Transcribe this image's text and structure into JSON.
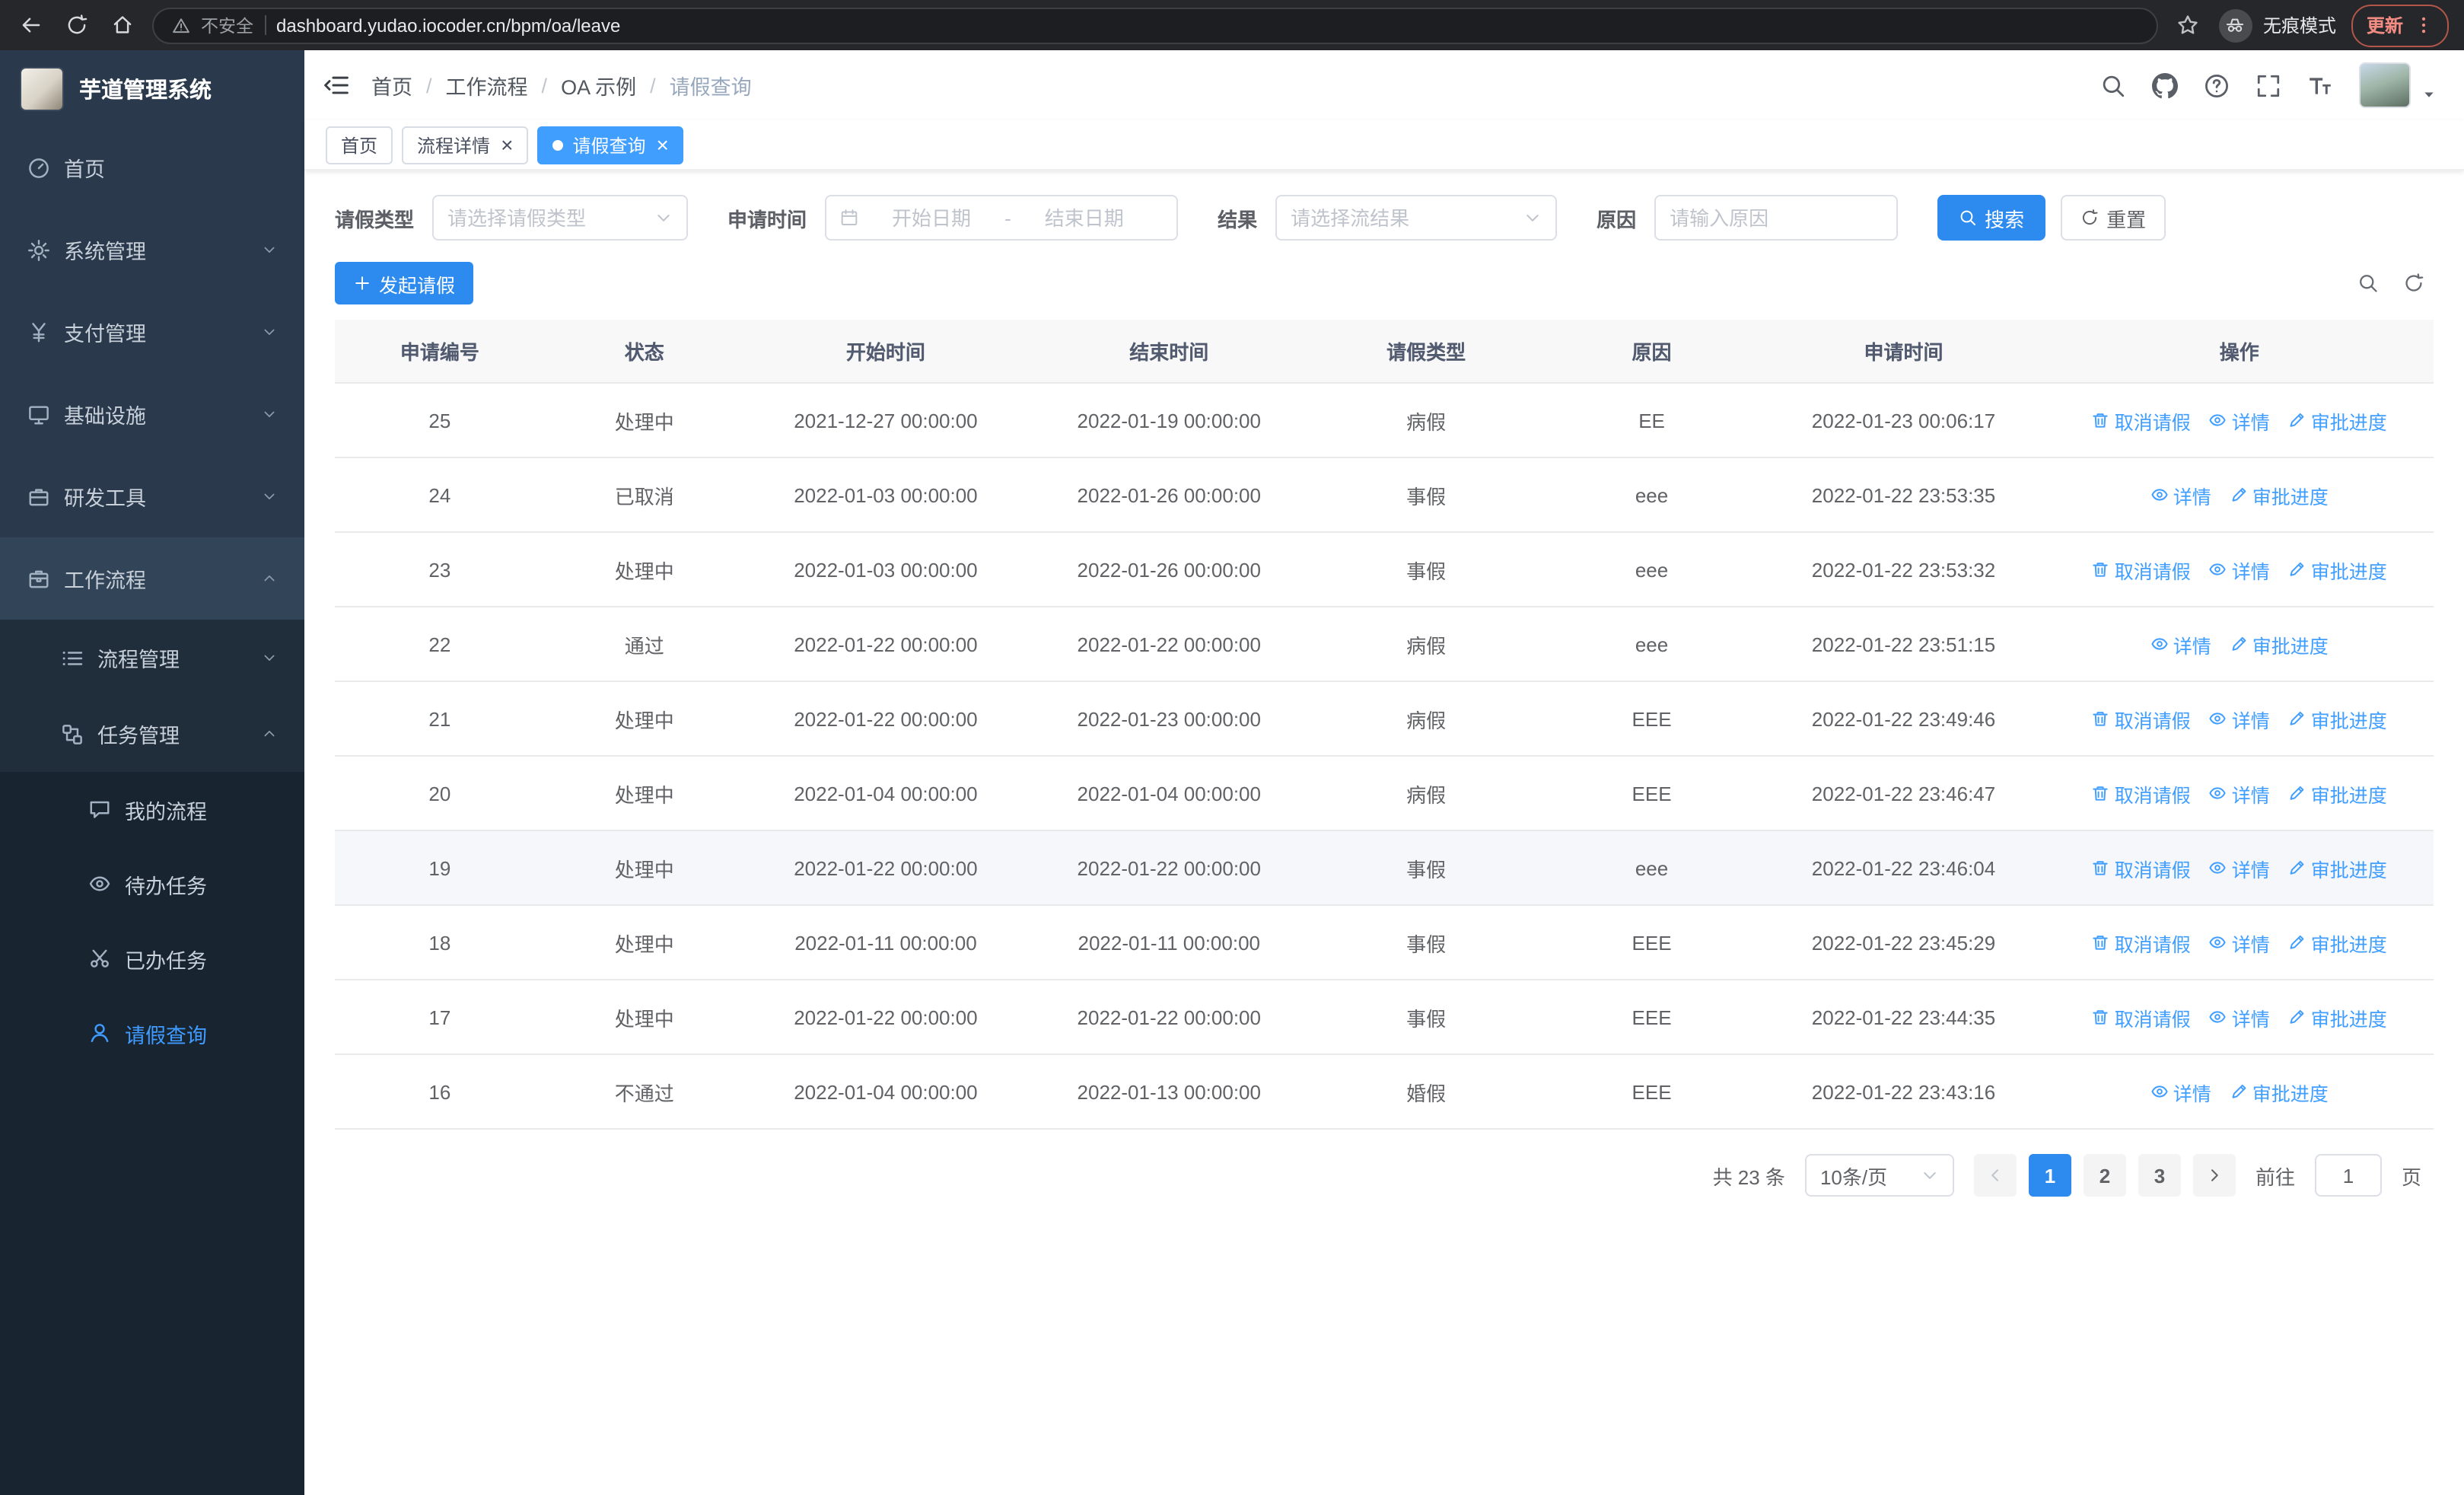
{
  "colors": {
    "primary": "#2d8bf0",
    "link": "#409eff",
    "sidebar_bg": "#2a3a4c",
    "sidebar_active_text": "#3f9bff",
    "tab_active_bg": "#409eff",
    "update_accent": "#f28b82",
    "table_header_bg": "#f8f8f9"
  },
  "browser": {
    "security_label": "不安全",
    "url": "dashboard.yudao.iocoder.cn/bpm/oa/leave",
    "incognito_label": "无痕模式",
    "update_label": "更新"
  },
  "sidebar": {
    "logo_title": "芋道管理系统",
    "menu": [
      {
        "key": "home",
        "label": "首页",
        "icon": "dashboard-icon",
        "level": 1
      },
      {
        "key": "system",
        "label": "系统管理",
        "icon": "gear-icon",
        "level": 1,
        "arrow": "down"
      },
      {
        "key": "payment",
        "label": "支付管理",
        "icon": "payment-icon",
        "level": 1,
        "arrow": "down"
      },
      {
        "key": "infrastructure",
        "label": "基础设施",
        "icon": "infrastructure-icon",
        "level": 1,
        "arrow": "down"
      },
      {
        "key": "devtools",
        "label": "研发工具",
        "icon": "devtools-icon",
        "level": 1,
        "arrow": "down"
      },
      {
        "key": "workflow",
        "label": "工作流程",
        "icon": "workflow-icon",
        "level": 1,
        "arrow": "up",
        "expanded": true
      },
      {
        "key": "process-mgmt",
        "label": "流程管理",
        "icon": "process-icon",
        "level": 2,
        "arrow": "down"
      },
      {
        "key": "task-mgmt",
        "label": "任务管理",
        "icon": "task-icon",
        "level": 2,
        "arrow": "up",
        "expanded": true
      },
      {
        "key": "my-process",
        "label": "我的流程",
        "icon": "my-process-icon",
        "level": 3
      },
      {
        "key": "todo-tasks",
        "label": "待办任务",
        "icon": "todo-icon",
        "level": 3
      },
      {
        "key": "done-tasks",
        "label": "已办任务",
        "icon": "done-icon",
        "level": 3
      },
      {
        "key": "leave-query",
        "label": "请假查询",
        "icon": "leave-icon",
        "level": 3,
        "active": true
      }
    ]
  },
  "header": {
    "breadcrumb": [
      "首页",
      "工作流程",
      "OA 示例",
      "请假查询"
    ],
    "breadcrumb_separator": "/"
  },
  "tabs": [
    {
      "key": "home",
      "label": "首页",
      "closable": false,
      "active": false
    },
    {
      "key": "process-detail",
      "label": "流程详情",
      "closable": true,
      "active": false
    },
    {
      "key": "leave-query",
      "label": "请假查询",
      "closable": true,
      "active": true
    }
  ],
  "filters": {
    "leave_type_label": "请假类型",
    "leave_type_placeholder": "请选择请假类型",
    "apply_time_label": "申请时间",
    "start_date_placeholder": "开始日期",
    "date_separator": "-",
    "end_date_placeholder": "结束日期",
    "result_label": "结果",
    "result_placeholder": "请选择流结果",
    "reason_label": "原因",
    "reason_placeholder": "请输入原因",
    "search_label": "搜索",
    "reset_label": "重置"
  },
  "toolbar": {
    "create_label": "发起请假"
  },
  "table": {
    "columns": [
      {
        "key": "id",
        "label": "申请编号"
      },
      {
        "key": "status",
        "label": "状态"
      },
      {
        "key": "start_time",
        "label": "开始时间"
      },
      {
        "key": "end_time",
        "label": "结束时间"
      },
      {
        "key": "leave_type",
        "label": "请假类型"
      },
      {
        "key": "reason",
        "label": "原因"
      },
      {
        "key": "apply_time",
        "label": "申请时间"
      },
      {
        "key": "actions",
        "label": "操作"
      }
    ],
    "action_defs": {
      "cancel": {
        "label": "取消请假",
        "icon": "trash-icon"
      },
      "detail": {
        "label": "详情",
        "icon": "eye-icon"
      },
      "progress": {
        "label": "审批进度",
        "icon": "edit-icon"
      }
    },
    "hovered_row": "19",
    "rows": [
      {
        "id": "25",
        "status": "处理中",
        "start_time": "2021-12-27 00:00:00",
        "end_time": "2022-01-19 00:00:00",
        "leave_type": "病假",
        "reason": "EE",
        "apply_time": "2022-01-23 00:06:17",
        "actions": [
          "cancel",
          "detail",
          "progress"
        ]
      },
      {
        "id": "24",
        "status": "已取消",
        "start_time": "2022-01-03 00:00:00",
        "end_time": "2022-01-26 00:00:00",
        "leave_type": "事假",
        "reason": "eee",
        "apply_time": "2022-01-22 23:53:35",
        "actions": [
          "detail",
          "progress"
        ]
      },
      {
        "id": "23",
        "status": "处理中",
        "start_time": "2022-01-03 00:00:00",
        "end_time": "2022-01-26 00:00:00",
        "leave_type": "事假",
        "reason": "eee",
        "apply_time": "2022-01-22 23:53:32",
        "actions": [
          "cancel",
          "detail",
          "progress"
        ]
      },
      {
        "id": "22",
        "status": "通过",
        "start_time": "2022-01-22 00:00:00",
        "end_time": "2022-01-22 00:00:00",
        "leave_type": "病假",
        "reason": "eee",
        "apply_time": "2022-01-22 23:51:15",
        "actions": [
          "detail",
          "progress"
        ]
      },
      {
        "id": "21",
        "status": "处理中",
        "start_time": "2022-01-22 00:00:00",
        "end_time": "2022-01-23 00:00:00",
        "leave_type": "病假",
        "reason": "EEE",
        "apply_time": "2022-01-22 23:49:46",
        "actions": [
          "cancel",
          "detail",
          "progress"
        ]
      },
      {
        "id": "20",
        "status": "处理中",
        "start_time": "2022-01-04 00:00:00",
        "end_time": "2022-01-04 00:00:00",
        "leave_type": "病假",
        "reason": "EEE",
        "apply_time": "2022-01-22 23:46:47",
        "actions": [
          "cancel",
          "detail",
          "progress"
        ]
      },
      {
        "id": "19",
        "status": "处理中",
        "start_time": "2022-01-22 00:00:00",
        "end_time": "2022-01-22 00:00:00",
        "leave_type": "事假",
        "reason": "eee",
        "apply_time": "2022-01-22 23:46:04",
        "actions": [
          "cancel",
          "detail",
          "progress"
        ]
      },
      {
        "id": "18",
        "status": "处理中",
        "start_time": "2022-01-11 00:00:00",
        "end_time": "2022-01-11 00:00:00",
        "leave_type": "事假",
        "reason": "EEE",
        "apply_time": "2022-01-22 23:45:29",
        "actions": [
          "cancel",
          "detail",
          "progress"
        ]
      },
      {
        "id": "17",
        "status": "处理中",
        "start_time": "2022-01-22 00:00:00",
        "end_time": "2022-01-22 00:00:00",
        "leave_type": "事假",
        "reason": "EEE",
        "apply_time": "2022-01-22 23:44:35",
        "actions": [
          "cancel",
          "detail",
          "progress"
        ]
      },
      {
        "id": "16",
        "status": "不通过",
        "start_time": "2022-01-04 00:00:00",
        "end_time": "2022-01-13 00:00:00",
        "leave_type": "婚假",
        "reason": "EEE",
        "apply_time": "2022-01-22 23:43:16",
        "actions": [
          "detail",
          "progress"
        ]
      }
    ]
  },
  "pagination": {
    "total_text": "共 23 条",
    "page_size_value": "10条/页",
    "pages": [
      "1",
      "2",
      "3"
    ],
    "active_page": "1",
    "prev_disabled": true,
    "goto_label": "前往",
    "goto_value": "1",
    "goto_suffix": "页"
  }
}
